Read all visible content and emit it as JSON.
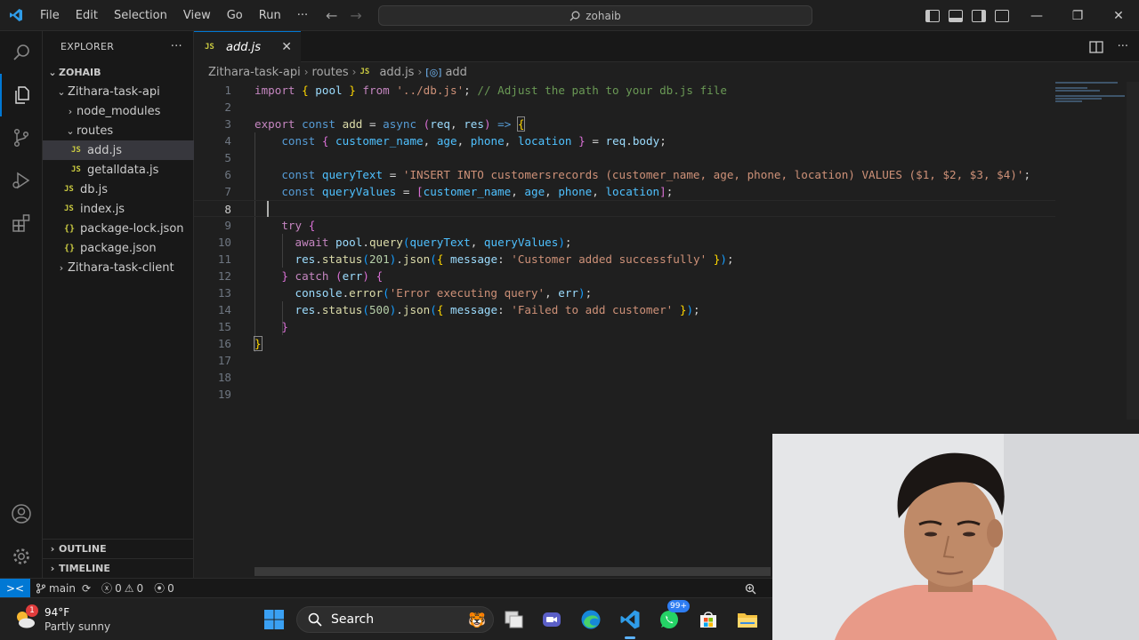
{
  "titlebar": {
    "menu": [
      "File",
      "Edit",
      "Selection",
      "View",
      "Go",
      "Run",
      "···"
    ],
    "search": "zohaib",
    "window_minimize": "—",
    "window_restore": "❐",
    "window_close": "✕"
  },
  "sidebar": {
    "title": "EXPLORER",
    "more": "···",
    "root": "ZOHAIB",
    "items": [
      {
        "label": "Zithara-task-api",
        "kind": "folder-open"
      },
      {
        "label": "node_modules",
        "kind": "folder"
      },
      {
        "label": "routes",
        "kind": "folder-open"
      },
      {
        "label": "add.js",
        "kind": "js"
      },
      {
        "label": "getalldata.js",
        "kind": "js"
      },
      {
        "label": "db.js",
        "kind": "js"
      },
      {
        "label": "index.js",
        "kind": "js"
      },
      {
        "label": "package-lock.json",
        "kind": "json"
      },
      {
        "label": "package.json",
        "kind": "json"
      },
      {
        "label": "Zithara-task-client",
        "kind": "folder"
      }
    ],
    "badge_js": "JS",
    "badge_json": "{}",
    "outline": "OUTLINE",
    "timeline": "TIMELINE"
  },
  "editor": {
    "tab": {
      "badge": "JS",
      "label": "add.js",
      "close": "✕"
    },
    "breadcrumb": [
      "Zithara-task-api",
      "routes",
      "add.js",
      "add"
    ],
    "breadcrumb_sep": "›",
    "line_numbers": [
      "1",
      "2",
      "3",
      "4",
      "5",
      "6",
      "7",
      "8",
      "9",
      "10",
      "11",
      "12",
      "13",
      "14",
      "15",
      "16",
      "17",
      "18",
      "19"
    ],
    "current_line": 8
  },
  "statusbar": {
    "remote": "><",
    "branch": "main",
    "errors": "0",
    "warnings": "0",
    "ports": "0"
  },
  "taskbar": {
    "temp": "94°F",
    "condition": "Partly sunny",
    "notification_count": "1",
    "search": "Search",
    "whatsapp_badge": "99+"
  },
  "colors": {
    "accent": "#0078d4",
    "keyword": "#569cd6",
    "control": "#c586c0",
    "string": "#ce9178",
    "function": "#dcdcaa",
    "variable": "#9cdcfe",
    "comment": "#6a9955",
    "number": "#b5cea8"
  }
}
